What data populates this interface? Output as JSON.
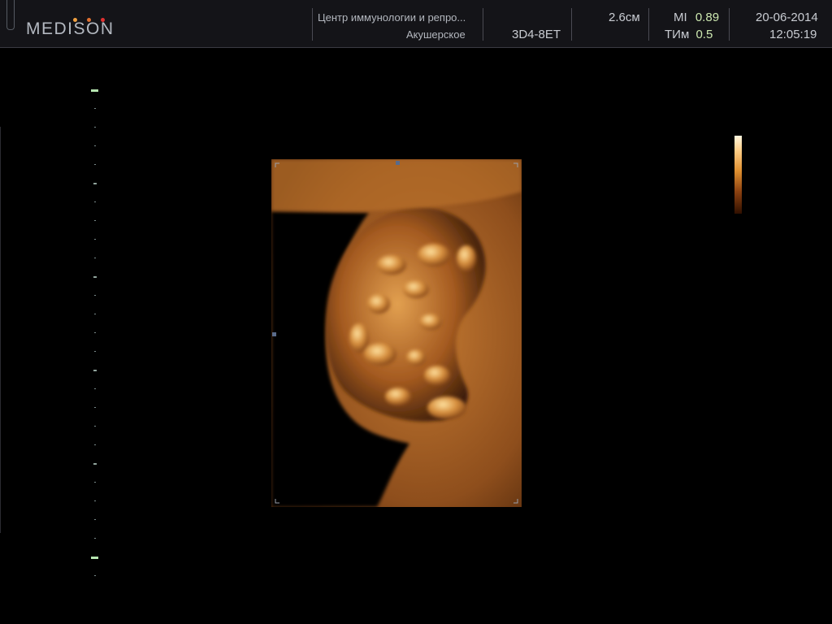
{
  "header": {
    "logo": "MEDISON",
    "clinic": "Центр иммунологии и репро...",
    "mode": "Акушерское",
    "probe": "3D4-8ET",
    "depth": "2.6см",
    "mi_label": "MI",
    "mi_value": "0.89",
    "ti_label": "ТИм",
    "ti_value": "0.5",
    "date": "20-06-2014",
    "time": "12:05:19"
  },
  "colors": {
    "logo_dots": [
      "#f0a040",
      "#e07030",
      "#e03030"
    ],
    "header_bg": "#141418",
    "value_green": "#cde8b0",
    "render_tone": "#c8782e"
  },
  "icons": {
    "volume_render": "fetus-3d-render",
    "colorbar": "sepia-gray-map",
    "roi_marker": "square-marker"
  }
}
